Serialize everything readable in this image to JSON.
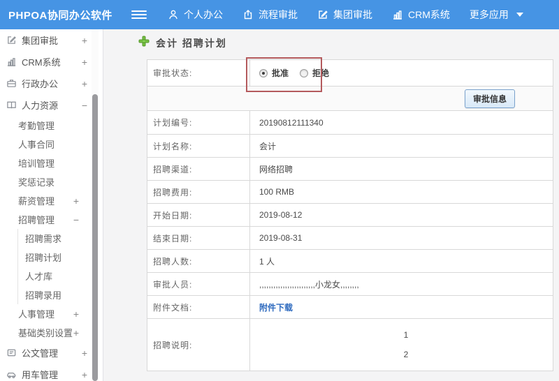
{
  "header": {
    "logo": "PHPOA协同办公软件",
    "nav": [
      {
        "label": "个人办公",
        "icon": "user-icon"
      },
      {
        "label": "流程审批",
        "icon": "process-approval-icon"
      },
      {
        "label": "集团审批",
        "icon": "edit-square-icon"
      },
      {
        "label": "CRM系统",
        "icon": "bar-chart-icon"
      },
      {
        "label": "更多应用",
        "icon": "caret-down-icon"
      }
    ]
  },
  "sidebar": {
    "items": [
      {
        "label": "集团审批",
        "icon": "edit-square-icon",
        "toggle": "+"
      },
      {
        "label": "CRM系统",
        "icon": "bar-chart-icon",
        "toggle": "+"
      },
      {
        "label": "行政办公",
        "icon": "briefcase-icon",
        "toggle": "+"
      },
      {
        "label": "人力资源",
        "icon": "book-icon",
        "toggle": "−"
      },
      {
        "label": "考勤管理",
        "toggle": ""
      },
      {
        "label": "人事合同",
        "toggle": ""
      },
      {
        "label": "培训管理",
        "toggle": ""
      },
      {
        "label": "奖惩记录",
        "toggle": ""
      },
      {
        "label": "薪资管理",
        "toggle": "+"
      },
      {
        "label": "招聘管理",
        "toggle": "−"
      },
      {
        "label": "招聘需求",
        "toggle": ""
      },
      {
        "label": "招聘计划",
        "toggle": ""
      },
      {
        "label": "人才库",
        "toggle": ""
      },
      {
        "label": "招聘录用",
        "toggle": ""
      },
      {
        "label": "人事管理",
        "toggle": "+"
      },
      {
        "label": "基础类别设置",
        "toggle": "+"
      },
      {
        "label": "公文管理",
        "icon": "document-icon",
        "toggle": "+"
      },
      {
        "label": "用车管理",
        "icon": "car-icon",
        "toggle": "+"
      }
    ]
  },
  "main": {
    "page_title": "会计 招聘计划",
    "title_icon": "green-plus-icon",
    "status_row": {
      "label": "审批状态:",
      "options": [
        {
          "label": "批准",
          "checked": true
        },
        {
          "label": "拒绝",
          "checked": false
        }
      ]
    },
    "approve_info_button": "审批信息",
    "fields": [
      {
        "label": "计划编号:",
        "value": "20190812111340"
      },
      {
        "label": "计划名称:",
        "value": "会计"
      },
      {
        "label": "招聘渠道:",
        "value": "网络招聘"
      },
      {
        "label": "招聘费用:",
        "value": "100 RMB"
      },
      {
        "label": "开始日期:",
        "value": "2019-08-12"
      },
      {
        "label": "结束日期:",
        "value": "2019-08-31"
      },
      {
        "label": "招聘人数:",
        "value": "1 人"
      },
      {
        "label": "审批人员:",
        "value": ",,,,,,,,,,,,,,,,,,,,,,,,小龙女,,,,,,,,"
      },
      {
        "label": "附件文档:",
        "value": "附件下载"
      },
      {
        "label": "招聘说明:",
        "value_lines": [
          "1",
          "2"
        ]
      }
    ],
    "colors": {
      "header_blue": "#4694e4",
      "highlight_red": "#b45a5d",
      "link_blue": "#2f6bbf"
    }
  }
}
